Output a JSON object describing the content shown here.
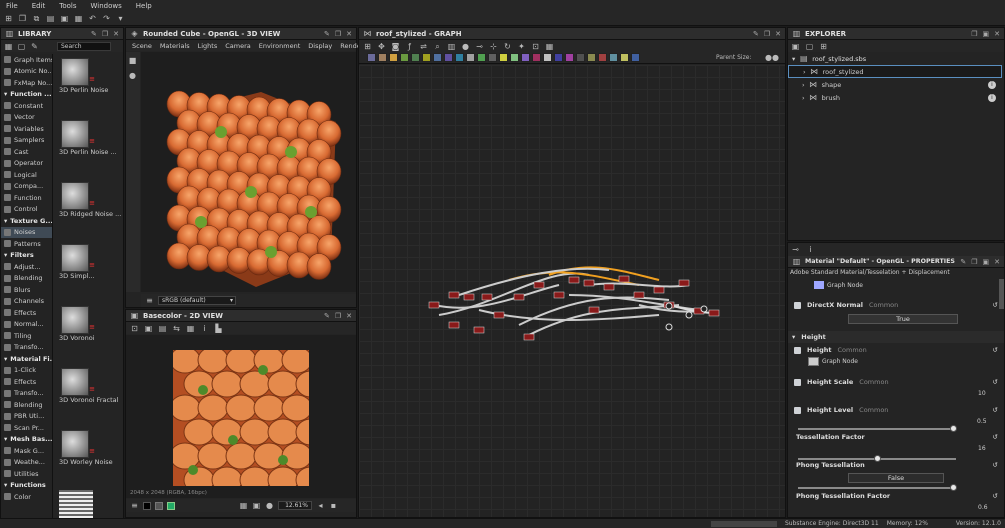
{
  "menu": [
    "File",
    "Edit",
    "Tools",
    "Windows",
    "Help"
  ],
  "library": {
    "title": "LIBRARY",
    "search_label": "Search",
    "categories": [
      {
        "label": "Graph Items",
        "head": false
      },
      {
        "label": "Atomic No...",
        "head": false
      },
      {
        "label": "FxMap No...",
        "head": false
      },
      {
        "label": "Function ...",
        "head": true
      },
      {
        "label": "Constant",
        "head": false
      },
      {
        "label": "Vector",
        "head": false
      },
      {
        "label": "Variables",
        "head": false
      },
      {
        "label": "Samplers",
        "head": false
      },
      {
        "label": "Cast",
        "head": false
      },
      {
        "label": "Operator",
        "head": false
      },
      {
        "label": "Logical",
        "head": false
      },
      {
        "label": "Compa...",
        "head": false
      },
      {
        "label": "Function",
        "head": false
      },
      {
        "label": "Control",
        "head": false
      },
      {
        "label": "Texture G...",
        "head": true
      },
      {
        "label": "Noises",
        "head": false,
        "sel": true
      },
      {
        "label": "Patterns",
        "head": false
      },
      {
        "label": "Filters",
        "head": true
      },
      {
        "label": "Adjust...",
        "head": false
      },
      {
        "label": "Blending",
        "head": false
      },
      {
        "label": "Blurs",
        "head": false
      },
      {
        "label": "Channels",
        "head": false
      },
      {
        "label": "Effects",
        "head": false
      },
      {
        "label": "Normal...",
        "head": false
      },
      {
        "label": "Tiling",
        "head": false
      },
      {
        "label": "Transfo...",
        "head": false
      },
      {
        "label": "Material Fi...",
        "head": true
      },
      {
        "label": "1-Click",
        "head": false
      },
      {
        "label": "Effects",
        "head": false
      },
      {
        "label": "Transfo...",
        "head": false
      },
      {
        "label": "Blending",
        "head": false
      },
      {
        "label": "PBR Uti...",
        "head": false
      },
      {
        "label": "Scan Pr...",
        "head": false
      },
      {
        "label": "Mesh Bas...",
        "head": true
      },
      {
        "label": "Mask G...",
        "head": false
      },
      {
        "label": "Weathe...",
        "head": false
      },
      {
        "label": "Utilities",
        "head": false
      },
      {
        "label": "Functions",
        "head": true
      },
      {
        "label": "Color",
        "head": false
      }
    ],
    "items": [
      {
        "label": "3D Perlin Noise"
      },
      {
        "label": "3D Perlin Noise ..."
      },
      {
        "label": "3D Ridged Noise ..."
      },
      {
        "label": "3D Simpl..."
      },
      {
        "label": "3D Voronoi"
      },
      {
        "label": "3D Voronoi Fractal"
      },
      {
        "label": "3D Worley Noise"
      }
    ]
  },
  "view3d": {
    "title": "Rounded Cube - OpenGL - 3D VIEW",
    "tabs": [
      "Scene",
      "Materials",
      "Lights",
      "Camera",
      "Environment",
      "Display",
      "Renderer"
    ],
    "colorspace": "sRGB (default)"
  },
  "view2d": {
    "title": "Basecolor - 2D VIEW",
    "zoom": "12.61%",
    "info": "2048 x 2048 (RGBA, 16bpc)"
  },
  "graph": {
    "title": "roof_stylized - GRAPH",
    "parent_size_label": "Parent Size:"
  },
  "explorer": {
    "title": "EXPLORER",
    "file": "roof_stylized.sbs",
    "items": [
      {
        "label": "roof_stylized",
        "selected": true
      },
      {
        "label": "shape",
        "selected": false
      },
      {
        "label": "brush",
        "selected": false
      }
    ]
  },
  "properties": {
    "title": "Material \"Default\" - OpenGL - PROPERTIES",
    "subtitle": "Adobe Standard Material/Tesselation + Displacement",
    "graph_node_top": "Graph Node",
    "directx_label": "DirectX Normal",
    "common": "Common",
    "directx_value": "True",
    "section_height": "Height",
    "height_label": "Height",
    "height_node": "Graph Node",
    "height_scale_label": "Height Scale",
    "height_scale_value": "10",
    "height_scale_frac": 0.98,
    "height_level_label": "Height Level",
    "height_level_value": "0.5",
    "height_level_frac": 0.5,
    "tess_factor_label": "Tessellation Factor",
    "tess_factor_value": "16",
    "tess_factor_frac": 0.98,
    "phong_label": "Phong Tessellation",
    "phong_value": "False",
    "phong_factor_label": "Phong Tessellation Factor",
    "phong_factor_value": "0.6",
    "phong_factor_frac": 0.6
  },
  "status": {
    "engine": "Substance Engine: Direct3D 11",
    "memory": "Memory: 12%",
    "version": "Version: 12.1.0"
  },
  "colors": {
    "accent": "#f0a020",
    "selection": "#3f4a55"
  }
}
